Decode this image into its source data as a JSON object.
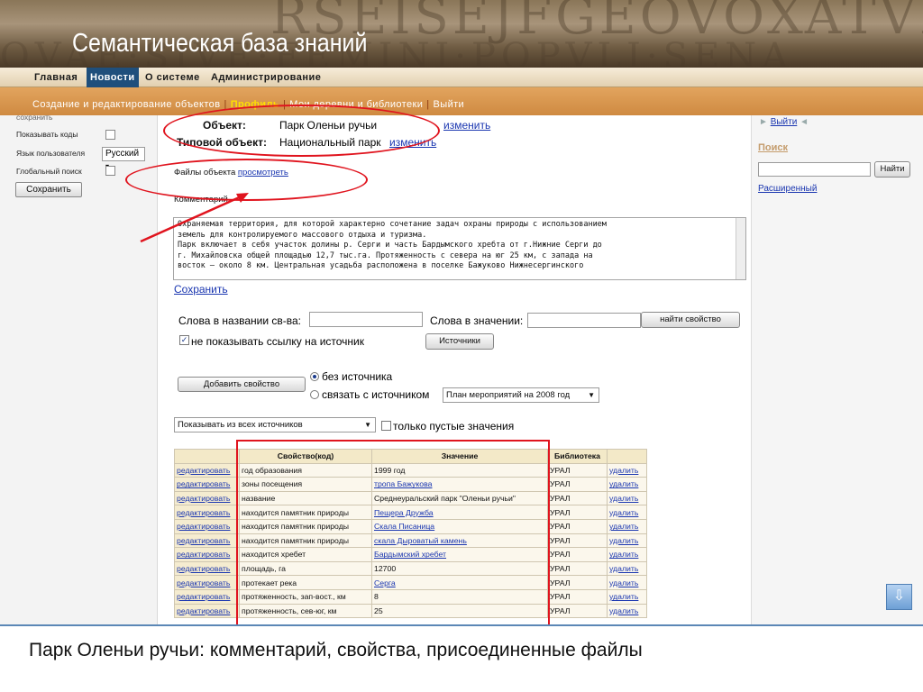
{
  "banner": {
    "site_title": "Семантическая база знаний",
    "bg_text_top": "RSEISEJFGEOVOXATVIVE SEFEIS",
    "bg_text_bottom": "QVAE·SIVE·FEMINI·POPVLI·SENA"
  },
  "mainnav": {
    "items": [
      "Главная",
      "Новости",
      "О системе",
      "Администрирование"
    ],
    "active": "Новости"
  },
  "subnav": {
    "items": [
      "Создание и редактирование объектов",
      "Профиль",
      "Мои деревни и библиотеки",
      "Выйти"
    ],
    "highlight": "Профиль"
  },
  "left_panel": {
    "truncated_top": "сохранить",
    "show_codes_label": "Показывать коды",
    "user_lang_label": "Язык пользователя",
    "user_lang_value": "Русский",
    "global_search_label": "Глобальный поиск",
    "save_button": "Сохранить"
  },
  "right_panel": {
    "logout_link": "Выйти",
    "search_title": "Поиск",
    "find_button": "Найти",
    "advanced_link": "Расширенный"
  },
  "object": {
    "object_label": "Объект:",
    "object_name": "Парк Оленьи ручьи",
    "change_link": "изменить",
    "type_label": "Типовой объект:",
    "type_value": "Национальный парк",
    "type_change_link": "изменить",
    "files_label": "Файлы объекта",
    "files_link": "просмотреть",
    "comment_label": "Комментарий",
    "comment_text": "Охраняемая территория, для которой характерно сочетание задач охраны природы с использованием\nземель для контролируемого массового отдыха и туризма.\nПарк включает в себя участок долины р. Серги и часть Бардымского хребта от г.Нижние Серги до\nг. Михайловска общей площадью 12,7 тыс.га. Протяженность с севера на юг 25 км, с запада на\nвосток – около 8 км. Центральная усадьба расположена в поселке Бажуково Нижнесергинского",
    "save_link": "Сохранить"
  },
  "search_props": {
    "words_in_name_label": "Слова в названии св-ва:",
    "words_in_value_label": "Слова в значении:",
    "find_property_button": "найти свойство",
    "no_source_link_label": "не показывать ссылку на источник",
    "sources_button": "Источники",
    "add_property_button": "Добавить свойство",
    "radio_no_source": "без источника",
    "radio_with_source": "связать с источником",
    "source_select_value": "План мероприятий на 2008 год",
    "filter_select_value": "Показывать из всех источников",
    "only_empty_label": "только пустые значения"
  },
  "table": {
    "headers": [
      "",
      "Свойство(код)",
      "Значение",
      "Библиотека",
      ""
    ],
    "edit_label": "редактировать",
    "delete_label": "удалить",
    "rows": [
      {
        "property": "год образования",
        "value": "1999 год",
        "value_is_link": false,
        "library": "УРАЛ"
      },
      {
        "property": "зоны посещения",
        "value": "тропа Бажукова",
        "value_is_link": true,
        "library": "УРАЛ"
      },
      {
        "property": "название",
        "value": "Среднеуральский парк \"Оленьи ручьи\"",
        "value_is_link": false,
        "library": "УРАЛ"
      },
      {
        "property": "находится памятник природы",
        "value": "Пещера Дружба",
        "value_is_link": true,
        "library": "УРАЛ"
      },
      {
        "property": "находится памятник природы",
        "value": "Скала Писаница",
        "value_is_link": true,
        "library": "УРАЛ"
      },
      {
        "property": "находится памятник природы",
        "value": "скала Дыроватый камень",
        "value_is_link": true,
        "library": "УРАЛ"
      },
      {
        "property": "находится хребет",
        "value": "Бардымский хребет",
        "value_is_link": true,
        "library": "УРАЛ"
      },
      {
        "property": "площадь, га",
        "value": "12700",
        "value_is_link": false,
        "library": "УРАЛ"
      },
      {
        "property": "протекает река",
        "value": "Серга",
        "value_is_link": true,
        "library": "УРАЛ"
      },
      {
        "property": "протяженность, зап-вост., км",
        "value": "8",
        "value_is_link": false,
        "library": "УРАЛ"
      },
      {
        "property": "протяженность, сев-юг, км",
        "value": "25",
        "value_is_link": false,
        "library": "УРАЛ"
      }
    ]
  },
  "caption": "Парк Оленьи ручьи: комментарий, свойства, присоединенные файлы",
  "annotation_color": "#e0141e"
}
